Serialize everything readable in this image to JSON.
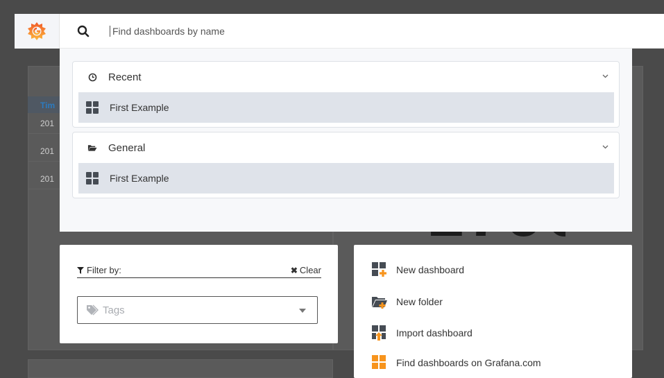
{
  "search": {
    "placeholder": "Find dashboards by name"
  },
  "background": {
    "table_header": "Tim",
    "rows": [
      "201",
      "201",
      "201"
    ],
    "big_stat": "1790"
  },
  "sections": [
    {
      "title": "Recent",
      "icon": "clock-icon",
      "items": [
        {
          "label": "First Example",
          "icon": "dashboard-grid-icon"
        }
      ]
    },
    {
      "title": "General",
      "icon": "folder-open-icon",
      "items": [
        {
          "label": "First Example",
          "icon": "dashboard-grid-icon"
        }
      ]
    }
  ],
  "filter": {
    "label": "Filter by:",
    "clear_label": "Clear",
    "tags_placeholder": "Tags"
  },
  "actions": [
    {
      "label": "New dashboard",
      "icon": "new-dashboard-icon"
    },
    {
      "label": "New folder",
      "icon": "new-folder-icon"
    },
    {
      "label": "Import dashboard",
      "icon": "import-dashboard-icon"
    },
    {
      "label": "Find dashboards on Grafana.com",
      "icon": "grafana-com-icon"
    }
  ],
  "colors": {
    "accent_orange": "#f7941d",
    "grid_icon": "#464c54",
    "selected_row": "#dfe3ea"
  }
}
